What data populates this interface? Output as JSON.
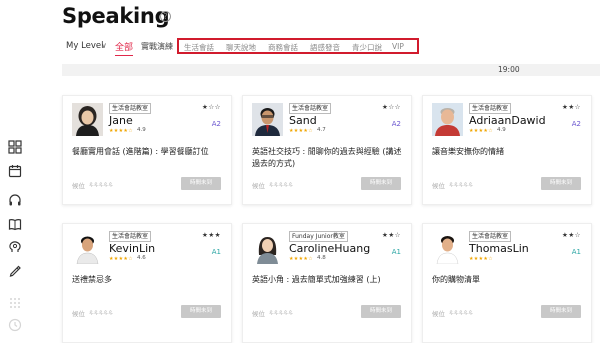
{
  "page": {
    "title": "Speaking",
    "help_icon": "?"
  },
  "filters": {
    "level_label": "My Level",
    "all_tab": "全部",
    "practice_tab": "實戰演練",
    "categories": [
      "生活會話",
      "聊天說地",
      "商務會話",
      "語感發音",
      "青少口說",
      "VIP"
    ]
  },
  "timebar": {
    "time": "19:00"
  },
  "accent_color": "#e0284a",
  "cards": [
    {
      "badge": "生活會話教室",
      "stars": "★☆☆",
      "name": "Jane",
      "rating_stars": "★★★★☆",
      "rating": "4.9",
      "level": "A2",
      "title": "餐廳實用會話 (進階篇) : 學習餐廳訂位",
      "wait_label": "候位",
      "button": "時間未到"
    },
    {
      "badge": "生活會話教室",
      "stars": "★☆☆",
      "name": "Sand",
      "rating_stars": "★★★★☆",
      "rating": "4.7",
      "level": "A2",
      "title": "英語社交技巧 : 閒聊你的過去與經驗 (講述過去的方式)",
      "wait_label": "候位",
      "button": "時間未到"
    },
    {
      "badge": "生活會話教室",
      "stars": "★★☆",
      "name": "AdriaanDawid",
      "rating_stars": "★★★★☆",
      "rating": "4.9",
      "level": "A2",
      "title": "讓音樂安撫你的情緒",
      "wait_label": "候位",
      "button": "時間未到"
    },
    {
      "badge": "生活會話教室",
      "stars": "★★★",
      "name": "KevinLin",
      "rating_stars": "★★★★☆",
      "rating": "4.6",
      "level": "A1",
      "title": "送禮禁忌多",
      "wait_label": "候位",
      "button": "時間未到"
    },
    {
      "badge": "Funday Junior教室",
      "stars": "★★☆",
      "name": "CarolineHuang",
      "rating_stars": "★★★★☆",
      "rating": "4.8",
      "level": "A1",
      "title": "英語小角 : 過去簡單式加強練習 (上)",
      "wait_label": "候位",
      "button": "時間未到"
    },
    {
      "badge": "生活會話教室",
      "stars": "★★☆",
      "name": "ThomasLin",
      "rating_stars": "★★★★☆",
      "rating": "",
      "level": "A1",
      "title": "你的購物清單",
      "wait_label": "候位",
      "button": "時間未到"
    }
  ],
  "wait_people": "ዹዹዹዹዹ",
  "sidebar_icons": [
    "grid-icon",
    "calendar-icon",
    "headphones-icon",
    "book-icon",
    "brain-icon",
    "pencil-icon",
    "apps-icon",
    "clock-icon"
  ]
}
